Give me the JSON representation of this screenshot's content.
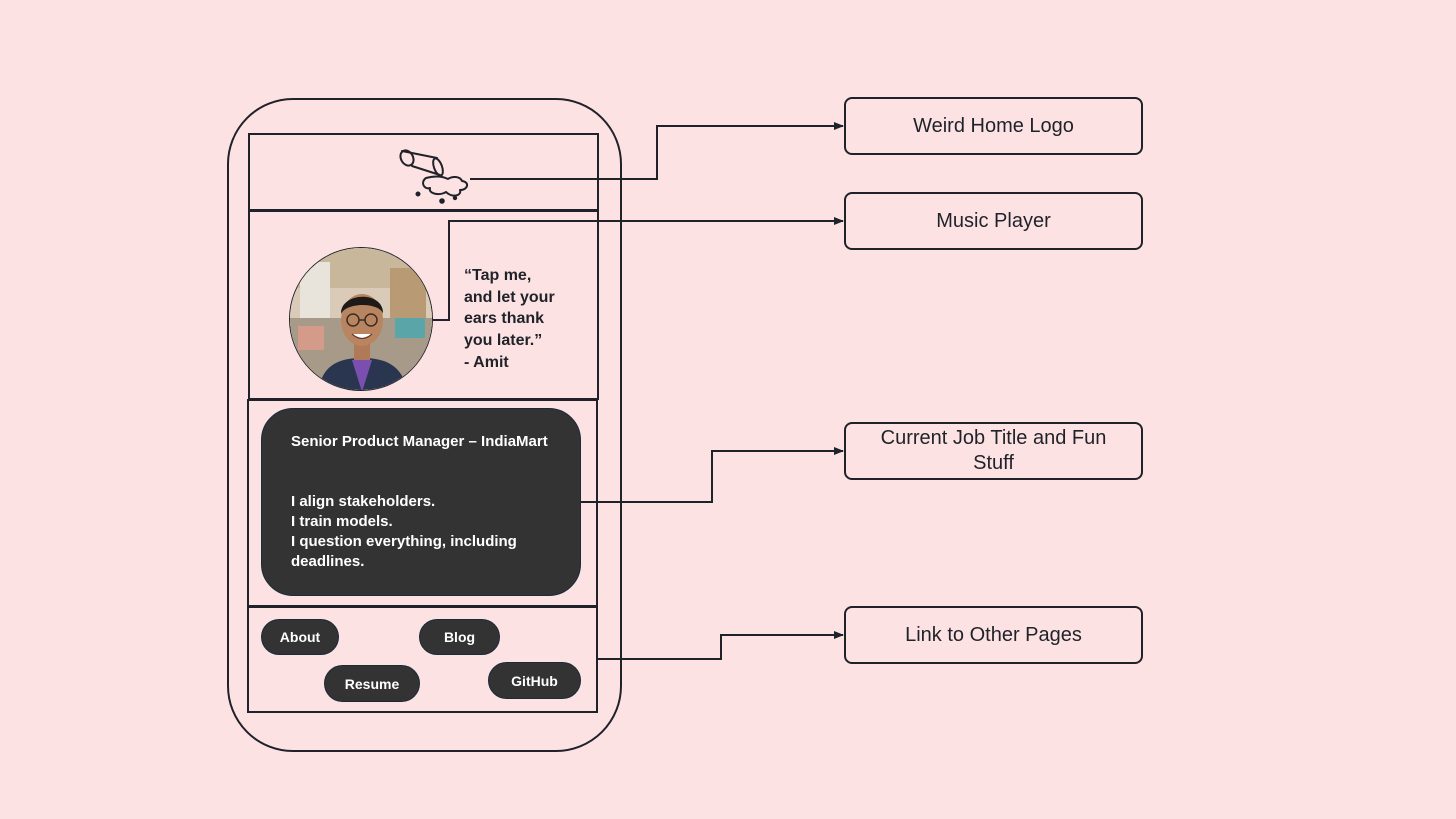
{
  "colors": {
    "background": "#fde2e4",
    "line": "#1f2329",
    "card": "#333333",
    "card_text": "#ffffff"
  },
  "phone": {
    "header": {
      "logo_icon": "spilled-cup-icon"
    },
    "player": {
      "avatar_icon": "profile-photo",
      "quote": "“Tap me,\nand let your\nears thank\nyou later.”\n- Amit"
    },
    "job": {
      "title": "Senior Product Manager – IndiaMart",
      "lines": [
        "I align stakeholders.",
        "I train models.",
        "I question everything, including deadlines."
      ]
    },
    "links": {
      "about": "About",
      "blog": "Blog",
      "resume": "Resume",
      "github": "GitHub"
    }
  },
  "callouts": [
    {
      "label": "Weird Home Logo"
    },
    {
      "label": "Music Player"
    },
    {
      "label": "Current Job Title and Fun Stuff"
    },
    {
      "label": "Link to Other Pages"
    }
  ]
}
